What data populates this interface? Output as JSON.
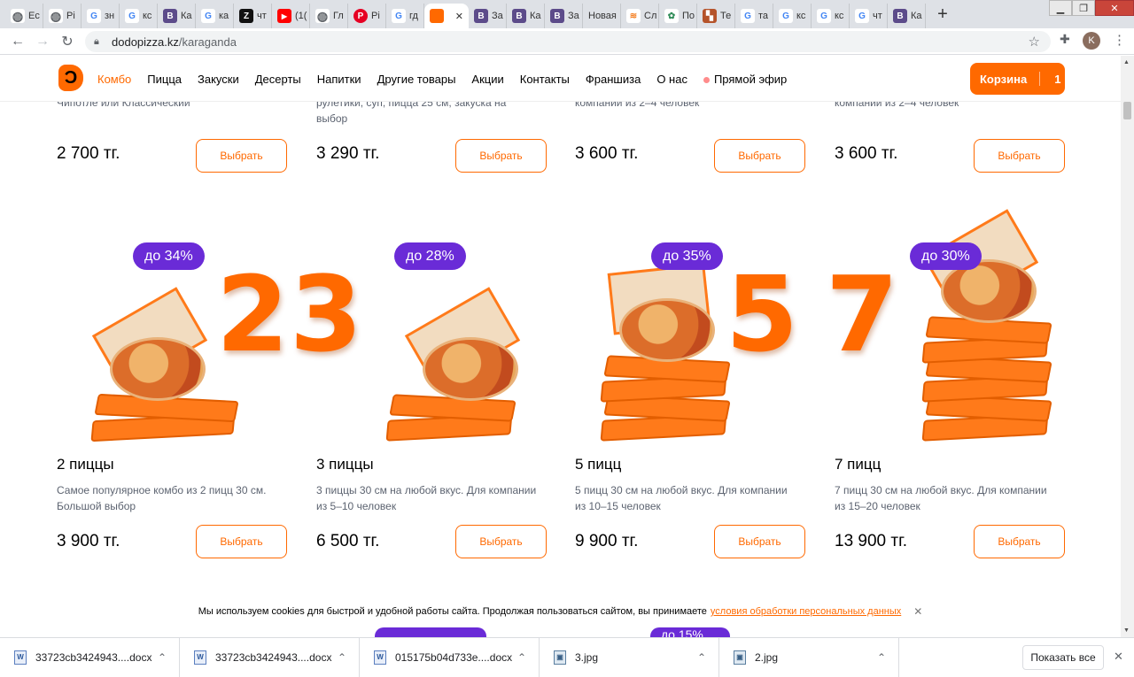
{
  "browser": {
    "tabs": [
      {
        "label": "Ec",
        "icon": "globe-icon",
        "color": "#5f6368"
      },
      {
        "label": "Pi",
        "icon": "globe-icon",
        "color": "#5f6368"
      },
      {
        "label": "зн",
        "icon": "google-icon",
        "color": "#4285f4"
      },
      {
        "label": "кс",
        "icon": "google-icon",
        "color": "#4285f4"
      },
      {
        "label": "Ка",
        "icon": "vk-icon",
        "color": "#5c4b8a"
      },
      {
        "label": "ка",
        "icon": "google-icon",
        "color": "#4285f4"
      },
      {
        "label": "чт",
        "icon": "z-icon",
        "color": "#111111"
      },
      {
        "label": "(1(",
        "icon": "youtube-icon",
        "color": "#ff0000"
      },
      {
        "label": "Гл",
        "icon": "globe-icon",
        "color": "#5f6368"
      },
      {
        "label": "Pi",
        "icon": "pinterest-icon",
        "color": "#e60023"
      },
      {
        "label": "гд",
        "icon": "google-icon",
        "color": "#4285f4"
      },
      {
        "label": "",
        "icon": "dodo-icon",
        "color": "#ff6900",
        "active": true
      },
      {
        "label": "За",
        "icon": "vk-icon",
        "color": "#5c4b8a"
      },
      {
        "label": "Ка",
        "icon": "vk-icon",
        "color": "#5c4b8a"
      },
      {
        "label": "За",
        "icon": "vk-icon",
        "color": "#5c4b8a"
      },
      {
        "label": "Новая",
        "icon": "",
        "color": ""
      },
      {
        "label": "Cл",
        "icon": "stack-icon",
        "color": "#f48024"
      },
      {
        "label": "По",
        "icon": "leaf-icon",
        "color": "#2e8b57"
      },
      {
        "label": "Те",
        "icon": "tile-icon",
        "color": "#b5532a"
      },
      {
        "label": "та",
        "icon": "google-icon",
        "color": "#4285f4"
      },
      {
        "label": "кс",
        "icon": "google-icon",
        "color": "#4285f4"
      },
      {
        "label": "кс",
        "icon": "google-icon",
        "color": "#4285f4"
      },
      {
        "label": "чт",
        "icon": "google-icon",
        "color": "#4285f4"
      },
      {
        "label": "Ка",
        "icon": "vk-icon",
        "color": "#5c4b8a"
      }
    ],
    "address": {
      "host": "dodopizza.kz",
      "path": "/karaganda"
    },
    "profile_initial": "K"
  },
  "header": {
    "nav": [
      "Комбо",
      "Пицца",
      "Закуски",
      "Десерты",
      "Напитки",
      "Другие товары",
      "Акции",
      "Контакты",
      "Франшиза",
      "О нас",
      "Прямой эфир"
    ],
    "cart_label": "Корзина",
    "cart_count": "1"
  },
  "top_cards": [
    {
      "desc": "Чипотле или Классический",
      "price": "2 700 тг.",
      "button": "Выбрать"
    },
    {
      "desc": "рулетики, суп, пицца 25 см, закуска на выбор",
      "price": "3 290 тг.",
      "button": "Выбрать"
    },
    {
      "desc": "компании из 2–4 человек",
      "price": "3 600 тг.",
      "button": "Выбрать"
    },
    {
      "desc": "компании из 2–4 человек",
      "price": "3 600 тг.",
      "button": "Выбрать"
    }
  ],
  "combo_cards": [
    {
      "badge": "до 34%",
      "number": "2",
      "title": "2 пиццы",
      "desc": "Самое популярное комбо из 2 пицц 30 см. Большой выбор",
      "price": "3 900 тг.",
      "button": "Выбрать"
    },
    {
      "badge": "до 28%",
      "number": "3",
      "title": "3 пиццы",
      "desc": "3 пиццы 30 см на любой вкус. Для компании из 5–10 человек",
      "price": "6 500 тг.",
      "button": "Выбрать"
    },
    {
      "badge": "до 35%",
      "number": "5",
      "title": "5 пицц",
      "desc": "5 пицц 30 см на любой вкус. Для компании из 10–15 человек",
      "price": "9 900 тг.",
      "button": "Выбрать"
    },
    {
      "badge": "до 30%",
      "number": "7",
      "title": "7 пицц",
      "desc": "7 пицц 30 см на любой вкус. Для компании из 15–20 человек",
      "price": "13 900 тг.",
      "button": "Выбрать"
    }
  ],
  "bottom_peek": [
    "",
    "до 15%"
  ],
  "cookie": {
    "text": "Мы используем cookies для быстрой и удобной работы сайта. Продолжая пользоваться сайтом, вы принимаете",
    "link": "условия обработки персональных данных",
    "close": "✕"
  },
  "downloads": {
    "items": [
      {
        "name": "33723cb3424943....docx",
        "type": "docx"
      },
      {
        "name": "33723cb3424943....docx",
        "type": "docx"
      },
      {
        "name": "015175b04d733e....docx",
        "type": "docx"
      },
      {
        "name": "3.jpg",
        "type": "jpg"
      },
      {
        "name": "2.jpg",
        "type": "jpg"
      }
    ],
    "show_all": "Показать все"
  },
  "colors": {
    "brand": "#ff6900",
    "badge": "#6a2bd7"
  }
}
